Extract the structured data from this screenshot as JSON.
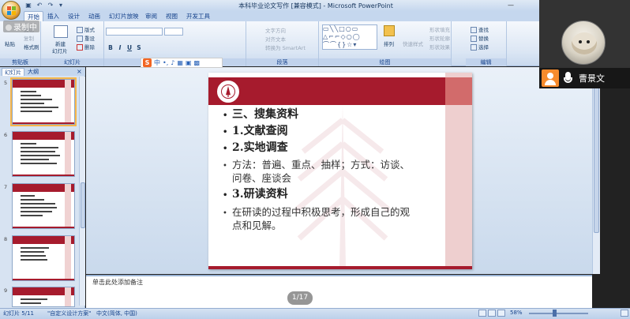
{
  "app": {
    "window_title": "本科毕业论文写作 [兼容模式] - Microsoft PowerPoint"
  },
  "recording": {
    "label": "录制中"
  },
  "ribbon": {
    "tabs": [
      "开始",
      "插入",
      "设计",
      "动画",
      "幻灯片放映",
      "审阅",
      "视图",
      "开发工具"
    ],
    "active_tab": "开始",
    "groups": [
      "剪贴板",
      "幻灯片",
      "字体",
      "段落",
      "绘图",
      "编辑"
    ],
    "clipboard": {
      "paste": "粘贴",
      "cut": "剪切",
      "copy": "复制",
      "format_painter": "格式刷"
    },
    "slides": {
      "new_slide": "新建",
      "new_slide2": "幻灯片",
      "layout": "版式",
      "reset": "重设",
      "delete": "删除"
    },
    "paragraph": {
      "text_direction": "文字方向",
      "align_text": "对齐文本",
      "smartart": "转换为 SmartArt"
    },
    "drawing": {
      "arrange": "排列",
      "quick_styles": "快速样式",
      "shape_fill": "形状填充",
      "shape_outline": "形状轮廓",
      "shape_effects": "形状效果"
    },
    "editing": {
      "find": "查找",
      "replace": "替换",
      "select": "选择"
    }
  },
  "ime": {
    "logo": "S",
    "mode": "中"
  },
  "left_pane": {
    "tabs": [
      "幻灯片",
      "大纲"
    ],
    "close": "×",
    "thumbnails": [
      {
        "num": "5",
        "selected": true
      },
      {
        "num": "6",
        "selected": false
      },
      {
        "num": "7",
        "selected": false
      },
      {
        "num": "8",
        "selected": false
      },
      {
        "num": "9",
        "selected": false
      }
    ]
  },
  "slide": {
    "bullets": [
      {
        "text": "三、搜集资料",
        "style": "big"
      },
      {
        "text": "1.文献查阅",
        "style": "big"
      },
      {
        "text": "2.实地调查",
        "style": "big"
      },
      {
        "text": "方法：普遍、重点、抽样；方式：访谈、",
        "style": "norm"
      },
      {
        "text": "问卷、座谈会",
        "style": "cont"
      },
      {
        "text": "3.研读资料",
        "style": "big"
      },
      {
        "text": "在研读的过程中积极思考，形成自己的观",
        "style": "norm"
      },
      {
        "text": "点和见解。",
        "style": "cont"
      }
    ],
    "bullet_char": "•"
  },
  "notes": {
    "placeholder": "单击此处添加备注"
  },
  "page_counter": "1/17",
  "status": {
    "slide_of": "幻灯片 5/11",
    "theme": "\"自定义设计方案\"",
    "language": "中文(简体, 中国)",
    "zoom": "58%",
    "zoom_value": 0.58
  },
  "video": {
    "user_name": "曹景文"
  },
  "colors": {
    "accent_red": "#a61b2d",
    "ribbon_blue": "#15428b"
  }
}
